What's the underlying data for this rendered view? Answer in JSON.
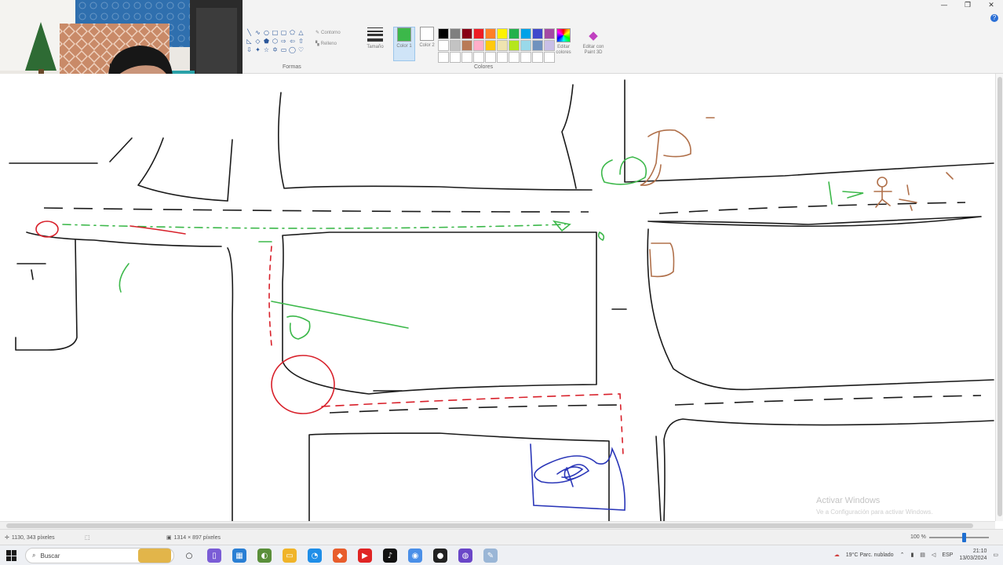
{
  "window": {
    "minimize_icon": "minimize-icon",
    "restore_icon": "restore-icon",
    "close_icon": "close-icon",
    "help_glyph": "?"
  },
  "ribbon": {
    "groups": {
      "shapes": "Formas",
      "colors": "Colores"
    },
    "shape_options": {
      "outline": "Contorno",
      "fill": "Relleno"
    },
    "tools": {
      "size": "Tamaño",
      "color1": "Color 1",
      "color2": "Color 2",
      "edit_colors": "Editar colores",
      "paint3d": "Editar con Paint 3D"
    },
    "color1": "#3cb84a",
    "color2": "#ffffff",
    "palette": [
      "#000000",
      "#7f7f7f",
      "#880015",
      "#ed1c24",
      "#ff7f27",
      "#fff200",
      "#22b14c",
      "#00a2e8",
      "#3f48cc",
      "#a349a4",
      "#ffffff",
      "#c3c3c3",
      "#b97a57",
      "#ffaec9",
      "#ffc90e",
      "#efe4b0",
      "#b5e61d",
      "#99d9ea",
      "#7092be",
      "#c8bfe7",
      "#ffffff",
      "#ffffff",
      "#ffffff",
      "#ffffff",
      "#ffffff",
      "#ffffff",
      "#ffffff",
      "#ffffff",
      "#ffffff",
      "#ffffff"
    ]
  },
  "canvas": {
    "stroke_colors": {
      "road": "#1a1a1a",
      "path_green": "#3cb84a",
      "path_red": "#d8202a",
      "person_brown": "#b0704a",
      "vehicle_blue": "#2a36b8"
    }
  },
  "watermark": {
    "title": "Activar Windows",
    "subtitle": "Ve a Configuración para activar Windows."
  },
  "statusbar": {
    "cursor_pos": "1130, 343 píxeles",
    "canvas_size": "1314 × 897 píxeles",
    "zoom": "100 %"
  },
  "taskbar": {
    "search_placeholder": "Buscar",
    "weather": "19°C  Parc. nublado",
    "language": "ESP",
    "time": "21:10",
    "date": "13/03/2024"
  }
}
